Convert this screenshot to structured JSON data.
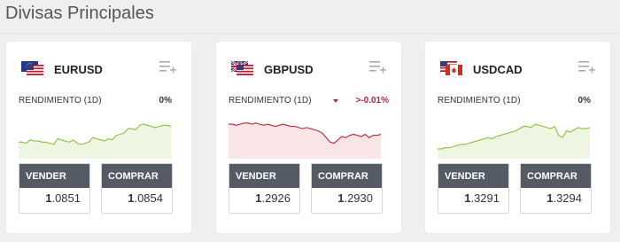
{
  "section_title": "Divisas Principales",
  "cards": [
    {
      "pair": "EURUSD",
      "flag": "eu-us-flag-icon",
      "rend_label": "RENDIMIENTO (1D)",
      "rend_value": "0%",
      "trend": "neutral",
      "sell_label": "VENDER",
      "buy_label": "COMPRAR",
      "sell_lead": "1",
      "sell_rest": ".0851",
      "buy_lead": "1",
      "buy_rest": ".0854",
      "line_color": "#8cbf3f",
      "fill_color": "#eef6e2",
      "spark": [
        10,
        10,
        9,
        12,
        11,
        11,
        10,
        10,
        9,
        8,
        13,
        12,
        11,
        10,
        12,
        9,
        8,
        9,
        10,
        14,
        13,
        12,
        11,
        13,
        12,
        16,
        17,
        18,
        22,
        22,
        21,
        25,
        26,
        25,
        24,
        23,
        24,
        25,
        25,
        24
      ]
    },
    {
      "pair": "GBPUSD",
      "flag": "gb-us-flag-icon",
      "rend_label": "RENDIMIENTO (1D)",
      "rend_value": ">-0.01%",
      "trend": "down",
      "sell_label": "VENDER",
      "buy_label": "COMPRAR",
      "sell_lead": "1",
      "sell_rest": ".2926",
      "buy_lead": "1",
      "buy_rest": ".2930",
      "line_color": "#b3263b",
      "fill_color": "#f9e4e6",
      "spark": [
        26,
        26,
        25,
        26,
        27,
        27,
        26,
        27,
        26,
        25,
        26,
        25,
        24,
        25,
        26,
        25,
        24,
        24,
        23,
        22,
        23,
        22,
        21,
        20,
        18,
        14,
        10,
        9,
        12,
        15,
        14,
        16,
        17,
        16,
        15,
        17,
        14,
        16,
        16,
        17
      ]
    },
    {
      "pair": "USDCAD",
      "flag": "us-ca-flag-icon",
      "rend_label": "RENDIMIENTO (1D)",
      "rend_value": "0%",
      "trend": "neutral",
      "sell_label": "VENDER",
      "buy_label": "COMPRAR",
      "sell_lead": "1",
      "sell_rest": ".3291",
      "buy_lead": "1",
      "buy_rest": ".3294",
      "line_color": "#8cbf3f",
      "fill_color": "#eef6e2",
      "spark": [
        4,
        4,
        5,
        5,
        6,
        7,
        8,
        8,
        9,
        10,
        11,
        12,
        13,
        14,
        13,
        15,
        16,
        17,
        18,
        19,
        20,
        22,
        24,
        24,
        23,
        26,
        25,
        24,
        23,
        22,
        24,
        16,
        14,
        20,
        19,
        21,
        23,
        22,
        22,
        23
      ]
    }
  ]
}
